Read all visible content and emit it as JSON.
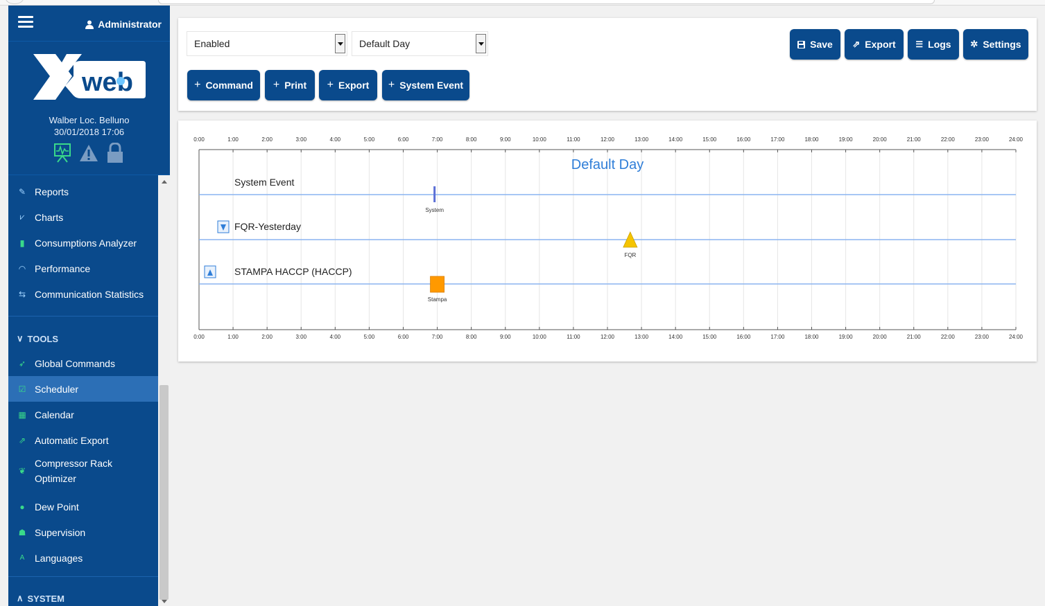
{
  "header": {
    "user": "Administrator"
  },
  "logo": {
    "text": "Xweb"
  },
  "site": {
    "name": "Walber Loc. Belluno",
    "datetime": "30/01/2018 17:06"
  },
  "sidebar": {
    "items": [
      {
        "label": "Reports",
        "icon": "reports-icon"
      },
      {
        "label": "Charts",
        "icon": "charts-icon"
      },
      {
        "label": "Consumptions Analyzer",
        "icon": "bar-chart-icon"
      },
      {
        "label": "Performance",
        "icon": "gauge-icon"
      },
      {
        "label": "Communication Statistics",
        "icon": "exchange-icon"
      }
    ],
    "tools_title": "TOOLS",
    "tools": [
      {
        "label": "Global Commands",
        "icon": "rocket-icon"
      },
      {
        "label": "Scheduler",
        "icon": "checkbox-icon",
        "active": true
      },
      {
        "label": "Calendar",
        "icon": "calendar-icon"
      },
      {
        "label": "Automatic Export",
        "icon": "export-icon"
      },
      {
        "label": "Compressor Rack",
        "label2": "Optimizer",
        "icon": "leaf-icon"
      },
      {
        "label": "Dew Point",
        "icon": "drop-icon"
      },
      {
        "label": "Supervision",
        "icon": "sitemap-icon"
      },
      {
        "label": "Languages",
        "icon": "language-icon"
      }
    ],
    "system_title": "SYSTEM"
  },
  "toolbar": {
    "status_select": "Enabled",
    "day_select": "Default Day",
    "save": "Save",
    "export": "Export",
    "logs": "Logs",
    "settings": "Settings",
    "add_command": "Command",
    "add_print": "Print",
    "add_export": "Export",
    "add_system_event": "System Event"
  },
  "schedule": {
    "title": "Default Day",
    "hours": [
      "0:00",
      "1:00",
      "2:00",
      "3:00",
      "4:00",
      "5:00",
      "6:00",
      "7:00",
      "8:00",
      "9:00",
      "10:00",
      "11:00",
      "12:00",
      "13:00",
      "14:00",
      "15:00",
      "16:00",
      "17:00",
      "18:00",
      "19:00",
      "20:00",
      "21:00",
      "22:00",
      "23:00",
      "24:00"
    ],
    "rows": [
      {
        "label": "System Event",
        "toggle": "none",
        "event": {
          "time": 6.92,
          "label": "System",
          "shape": "bar",
          "color": "#5b6fd6"
        }
      },
      {
        "label": "FQR-Yesterday",
        "toggle": "down",
        "event": {
          "time": 12.67,
          "label": "FQR",
          "shape": "triangle",
          "color": "#f5c400"
        }
      },
      {
        "label": "STAMPA HACCP (HACCP)",
        "toggle": "up",
        "event": {
          "time": 7.0,
          "label": "Stampa",
          "shape": "square",
          "color": "#ff9900"
        }
      }
    ],
    "accent": "#2f7ed8",
    "line_color": "#8ab4f0"
  },
  "colors": {
    "brand": "#0a4a8c",
    "active": "#2c6fb6"
  }
}
